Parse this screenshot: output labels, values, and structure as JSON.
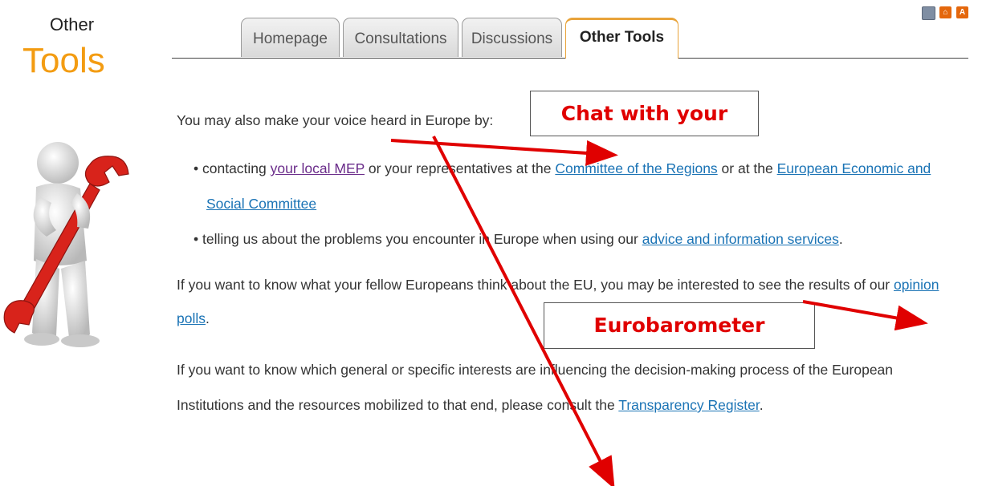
{
  "sidebar": {
    "title_small": "Other",
    "title_big": "Tools"
  },
  "toolbar": {
    "print_icon": "print-icon",
    "sitemap_icon": "sitemap-icon",
    "textsize_icon": "text-size-icon"
  },
  "tabs": [
    {
      "label": "Homepage",
      "active": false
    },
    {
      "label": "Consultations",
      "active": false
    },
    {
      "label": "Discussions",
      "active": false
    },
    {
      "label": "Other Tools",
      "active": true
    }
  ],
  "content": {
    "intro": "You may also make your voice heard in Europe by:",
    "bullet1": {
      "t1": "contacting ",
      "link_mep": "your local MEP",
      "t2": " or your representatives at the ",
      "link_cor": "Committee of the Regions",
      "t3": " or at the ",
      "link_eesc_1": "European Economic and",
      "link_eesc_2": "Social Committee"
    },
    "bullet2": {
      "t1": "telling us about the problems you encounter in Europe when using our ",
      "link_services": "advice and information services",
      "t2": "."
    },
    "para2": {
      "t1": "If you want to know what your fellow Europeans think about the EU, you may be interested to see the results of our ",
      "link_opinion_1": "opinion",
      "link_opinion_2": "polls",
      "t2": "."
    },
    "para3": {
      "line1": "If you want to know which general or specific interests are influencing the decision-making process of the European",
      "t1": "Institutions and the resources mobilized to that end, please consult the ",
      "link_register": "Transparency Register",
      "t2": "."
    }
  },
  "annotations": {
    "callout_chat": "Chat with your",
    "callout_eurobarometer": "Eurobarometer",
    "arrow_color": "#e00000"
  },
  "colors": {
    "accent": "#f39c12",
    "link": "#1a73b5",
    "visited_link": "#6a2c8a"
  }
}
